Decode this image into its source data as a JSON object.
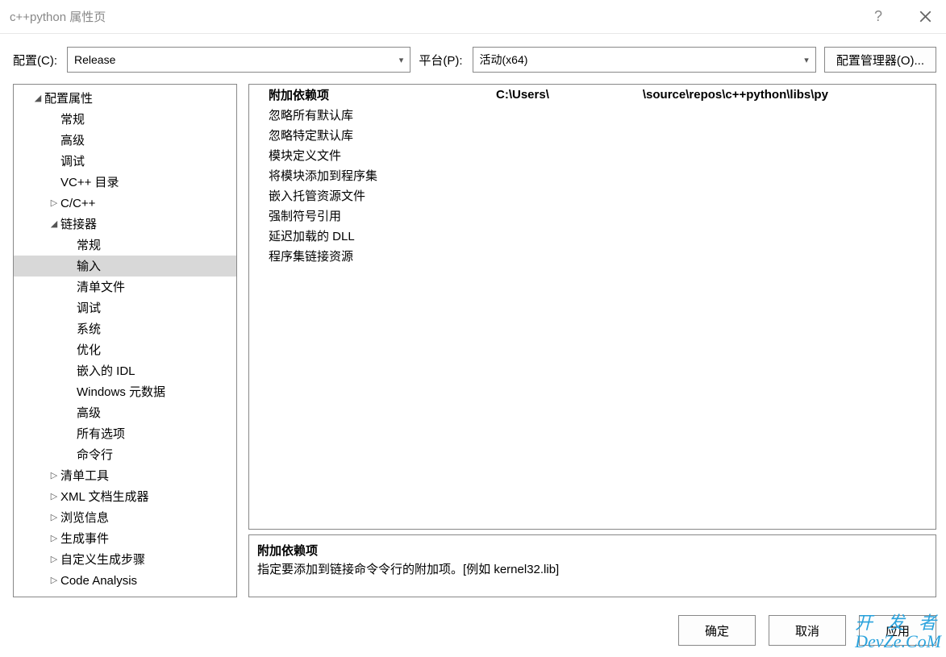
{
  "window": {
    "title": "c++python 属性页",
    "help": "?",
    "close": "×"
  },
  "top": {
    "config_label": "配置(C):",
    "config_value": "Release",
    "platform_label": "平台(P):",
    "platform_value": "活动(x64)",
    "config_manager": "配置管理器(O)..."
  },
  "tree": {
    "root": "配置属性",
    "items": [
      {
        "label": "常规",
        "indent": 58
      },
      {
        "label": "高级",
        "indent": 58
      },
      {
        "label": "调试",
        "indent": 58
      },
      {
        "label": "VC++ 目录",
        "indent": 58
      },
      {
        "label": "C/C++",
        "indent": 42,
        "toggle": "▷"
      },
      {
        "label": "链接器",
        "indent": 42,
        "toggle": "◢",
        "expanded": true
      },
      {
        "label": "常规",
        "indent": 78,
        "parent": "链接器"
      },
      {
        "label": "输入",
        "indent": 78,
        "parent": "链接器",
        "selected": true
      },
      {
        "label": "清单文件",
        "indent": 78,
        "parent": "链接器"
      },
      {
        "label": "调试",
        "indent": 78,
        "parent": "链接器"
      },
      {
        "label": "系统",
        "indent": 78,
        "parent": "链接器"
      },
      {
        "label": "优化",
        "indent": 78,
        "parent": "链接器"
      },
      {
        "label": "嵌入的 IDL",
        "indent": 78,
        "parent": "链接器"
      },
      {
        "label": "Windows 元数据",
        "indent": 78,
        "parent": "链接器"
      },
      {
        "label": "高级",
        "indent": 78,
        "parent": "链接器"
      },
      {
        "label": "所有选项",
        "indent": 78,
        "parent": "链接器"
      },
      {
        "label": "命令行",
        "indent": 78,
        "parent": "链接器"
      },
      {
        "label": "清单工具",
        "indent": 42,
        "toggle": "▷"
      },
      {
        "label": "XML 文档生成器",
        "indent": 42,
        "toggle": "▷"
      },
      {
        "label": "浏览信息",
        "indent": 42,
        "toggle": "▷"
      },
      {
        "label": "生成事件",
        "indent": 42,
        "toggle": "▷"
      },
      {
        "label": "自定义生成步骤",
        "indent": 42,
        "toggle": "▷"
      },
      {
        "label": "Code Analysis",
        "indent": 42,
        "toggle": "▷"
      }
    ]
  },
  "grid": {
    "rows": [
      {
        "label": "附加依赖项",
        "value_prefix": "C:\\Users\\",
        "value_suffix": "\\source\\repos\\c++python\\libs\\py",
        "selected": true
      },
      {
        "label": "忽略所有默认库"
      },
      {
        "label": "忽略特定默认库"
      },
      {
        "label": "模块定义文件"
      },
      {
        "label": "将模块添加到程序集"
      },
      {
        "label": "嵌入托管资源文件"
      },
      {
        "label": "强制符号引用"
      },
      {
        "label": "延迟加载的 DLL"
      },
      {
        "label": "程序集链接资源"
      }
    ]
  },
  "description": {
    "title": "附加依赖项",
    "body": "指定要添加到链接命令令行的附加项。[例如 kernel32.lib]"
  },
  "footer": {
    "ok": "确定",
    "cancel": "取消",
    "apply": "应用"
  },
  "watermark": {
    "line1": "开 发 者",
    "line2": "DevZe.CoM"
  }
}
